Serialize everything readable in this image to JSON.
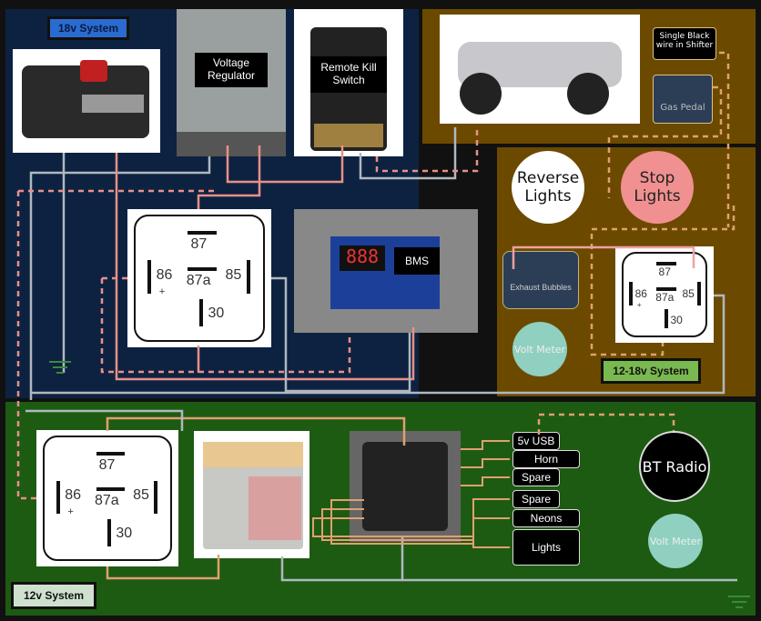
{
  "systems": {
    "s18": "18v System",
    "s1218": "12-18v System",
    "s12": "12v System"
  },
  "components": {
    "voltage_regulator": "Voltage Regulator",
    "remote_kill": "Remote Kill Switch",
    "bms": "BMS",
    "bms_display": "888",
    "shifter": "Single Black wire in Shifter",
    "gas_pedal": "Gas Pedal",
    "reverse": "Reverse Lights",
    "stop": "Stop Lights",
    "exhaust": "Exhaust Bubbles",
    "volt_meter": "Volt Meter",
    "bt_radio": "BT Radio"
  },
  "relay_pins": {
    "p87": "87",
    "p87a": "87a",
    "p86": "86",
    "p85": "85",
    "p30": "30",
    "plus": "+"
  },
  "fuse_outputs": [
    "5v USB",
    "Horn",
    "Spare",
    "Spare",
    "Neons",
    "Lights"
  ],
  "colors": {
    "hot": "#e8908a",
    "ground": "#b0b8c0",
    "signal": "#e0a070"
  }
}
